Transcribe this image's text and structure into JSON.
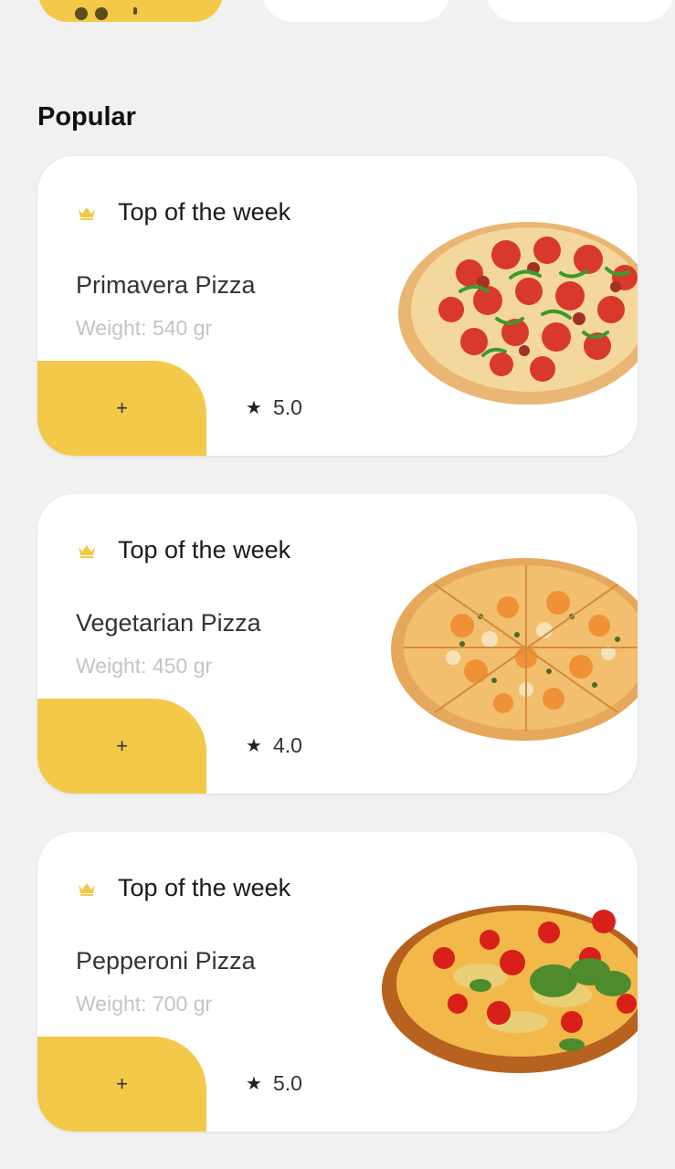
{
  "section": {
    "title": "Popular"
  },
  "cards": [
    {
      "badge": "Top of the week",
      "name": "Primavera Pizza",
      "weight": "Weight: 540 gr",
      "add_label": "+",
      "rating": "5.0",
      "style": "pepperoni-pepper"
    },
    {
      "badge": "Top of the week",
      "name": "Vegetarian Pizza",
      "weight": "Weight: 450 gr",
      "add_label": "+",
      "rating": "4.0",
      "style": "cheese-herb"
    },
    {
      "badge": "Top of the week",
      "name": "Pepperoni Pizza",
      "weight": "Weight: 700 gr",
      "add_label": "+",
      "rating": "5.0",
      "style": "tomato-basil"
    }
  ],
  "colors": {
    "accent": "#f3c94a",
    "background": "#f1f1f1",
    "card": "#ffffff",
    "muted": "#c4c4c4"
  }
}
